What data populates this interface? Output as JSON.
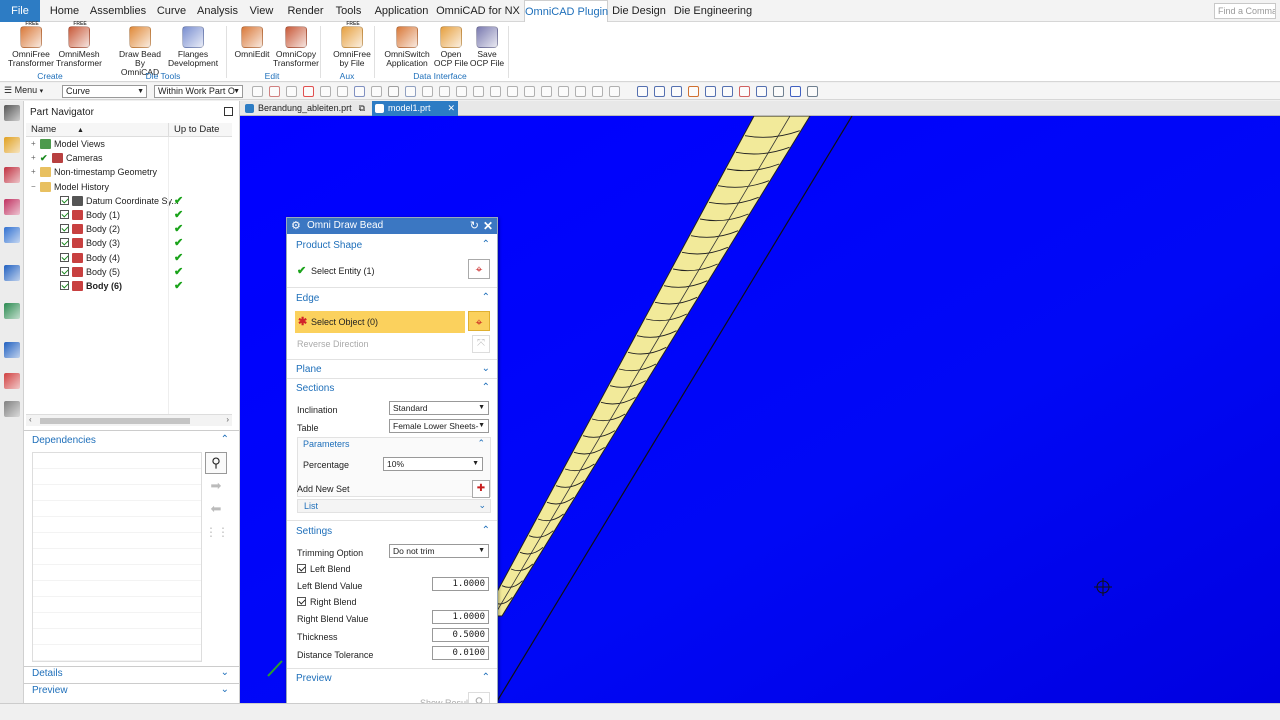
{
  "menu_tabs": [
    "File",
    "Home",
    "Assemblies",
    "Curve",
    "Analysis",
    "View",
    "Render",
    "Tools",
    "Application",
    "OmniCAD for NX",
    "OmniCAD Plugin",
    "Die Design",
    "Die Engineering"
  ],
  "search": {
    "placeholder": "Find a Command"
  },
  "ribbon": {
    "buttons": [
      {
        "line1": "OmniFree",
        "line2": "Transformer",
        "free": "FREE",
        "icon": "omnifree-icon",
        "color": "#d9793a"
      },
      {
        "line1": "OmniMesh",
        "line2": "Transformer",
        "free": "FREE",
        "icon": "omnimesh-icon",
        "color": "#c85a3a"
      },
      {
        "line1": "Draw Bead",
        "line2": "By OmniCAD",
        "free": "",
        "icon": "draw-bead-icon",
        "color": "#e08a3a"
      },
      {
        "line1": "Flanges",
        "line2": "Development",
        "free": "",
        "icon": "flanges-icon",
        "color": "#7a8fd0"
      },
      {
        "line1": "OmniEdit",
        "line2": "",
        "free": "",
        "icon": "omniedit-icon",
        "color": "#d9793a"
      },
      {
        "line1": "OmniCopy",
        "line2": "Transformer",
        "free": "",
        "icon": "omnicopy-icon",
        "color": "#c85a3a"
      },
      {
        "line1": "OmniFree",
        "line2": "by File",
        "free": "FREE",
        "icon": "omnifree-file-icon",
        "color": "#e6a040"
      },
      {
        "line1": "OmniSwitch",
        "line2": "Application",
        "free": "",
        "icon": "omniswitch-icon",
        "color": "#d9793a"
      },
      {
        "line1": "Open",
        "line2": "OCP File",
        "free": "",
        "icon": "open-file-icon",
        "color": "#e6a040"
      },
      {
        "line1": "Save",
        "line2": "OCP File",
        "free": "",
        "icon": "save-file-icon",
        "color": "#7a7ab0"
      }
    ],
    "groups": [
      "Create",
      "Die Tools",
      "Edit",
      "Aux",
      "Data Interface"
    ]
  },
  "toolbar": {
    "menu_label": "Menu",
    "filter_value": "Curve",
    "scope_value": "Within Work Part O"
  },
  "navigator": {
    "title": "Part Navigator",
    "col_name": "Name",
    "col_uptodate": "Up to Date",
    "rows": [
      {
        "label": "Model Views",
        "toggle": "+",
        "check": false,
        "bold": false,
        "ok": false,
        "indent": 0,
        "icon": "model-views-icon",
        "color": "#4c9a4c"
      },
      {
        "label": "Cameras",
        "toggle": "+",
        "check": true,
        "bold": false,
        "ok": false,
        "indent": 0,
        "icon": "camera-icon",
        "color": "#b84040"
      },
      {
        "label": "Non-timestamp Geometry",
        "toggle": "+",
        "check": false,
        "bold": false,
        "ok": false,
        "indent": 0,
        "icon": "folder-icon",
        "color": "#e8c060"
      },
      {
        "label": "Model History",
        "toggle": "-",
        "check": false,
        "bold": false,
        "ok": false,
        "indent": 0,
        "icon": "folder-icon",
        "color": "#e8c060"
      },
      {
        "label": "Datum Coordinate Sy...",
        "toggle": "",
        "check": true,
        "bold": false,
        "ok": true,
        "indent": 1,
        "icon": "datum-csys-icon",
        "color": "#555555"
      },
      {
        "label": "Body (1)",
        "toggle": "",
        "check": true,
        "bold": false,
        "ok": true,
        "indent": 1,
        "icon": "body-icon",
        "color": "#c84040"
      },
      {
        "label": "Body (2)",
        "toggle": "",
        "check": true,
        "bold": false,
        "ok": true,
        "indent": 1,
        "icon": "body-icon",
        "color": "#c84040"
      },
      {
        "label": "Body (3)",
        "toggle": "",
        "check": true,
        "bold": false,
        "ok": true,
        "indent": 1,
        "icon": "body-icon",
        "color": "#c84040"
      },
      {
        "label": "Body (4)",
        "toggle": "",
        "check": true,
        "bold": false,
        "ok": true,
        "indent": 1,
        "icon": "body-icon",
        "color": "#c84040"
      },
      {
        "label": "Body (5)",
        "toggle": "",
        "check": true,
        "bold": false,
        "ok": true,
        "indent": 1,
        "icon": "body-icon",
        "color": "#c84040"
      },
      {
        "label": "Body (6)",
        "toggle": "",
        "check": true,
        "bold": true,
        "ok": true,
        "indent": 1,
        "icon": "body-icon",
        "color": "#c84040"
      }
    ],
    "dependencies": "Dependencies",
    "details": "Details",
    "preview": "Preview"
  },
  "doc_tabs": [
    {
      "label": "Berandung_ableiten.prt",
      "active": false
    },
    {
      "label": "model1.prt",
      "active": true
    }
  ],
  "dialog": {
    "title": "Omni Draw Bead",
    "product_shape": "Product Shape",
    "select_entity": "Select Entity (1)",
    "edge": "Edge",
    "select_object": "Select Object (0)",
    "reverse_direction": "Reverse Direction",
    "plane": "Plane",
    "sections": "Sections",
    "inclination_label": "Inclination",
    "inclination_value": "Standard",
    "table_label": "Table",
    "table_value": "Female Lower Sheets-",
    "parameters": "Parameters",
    "percentage_label": "Percentage",
    "percentage_value": "10%",
    "add_new_set": "Add New Set",
    "list": "List",
    "settings": "Settings",
    "trimming_label": "Trimming Option",
    "trimming_value": "Do not trim",
    "left_blend": "Left Blend",
    "left_blend_value_label": "Left Blend Value",
    "left_blend_value": "1.0000",
    "right_blend": "Right Blend",
    "right_blend_value_label": "Right Blend Value",
    "right_blend_value": "1.0000",
    "thickness_label": "Thickness",
    "thickness_value": "0.5000",
    "distance_label": "Distance Tolerance",
    "distance_value": "0.0100",
    "preview": "Preview",
    "show_result": "Show Result"
  },
  "colors": {
    "viewport_bg": "#0000ff",
    "bead": "#f2ea9a",
    "accent": "#1e6fba",
    "highlight": "#fbd15d"
  }
}
